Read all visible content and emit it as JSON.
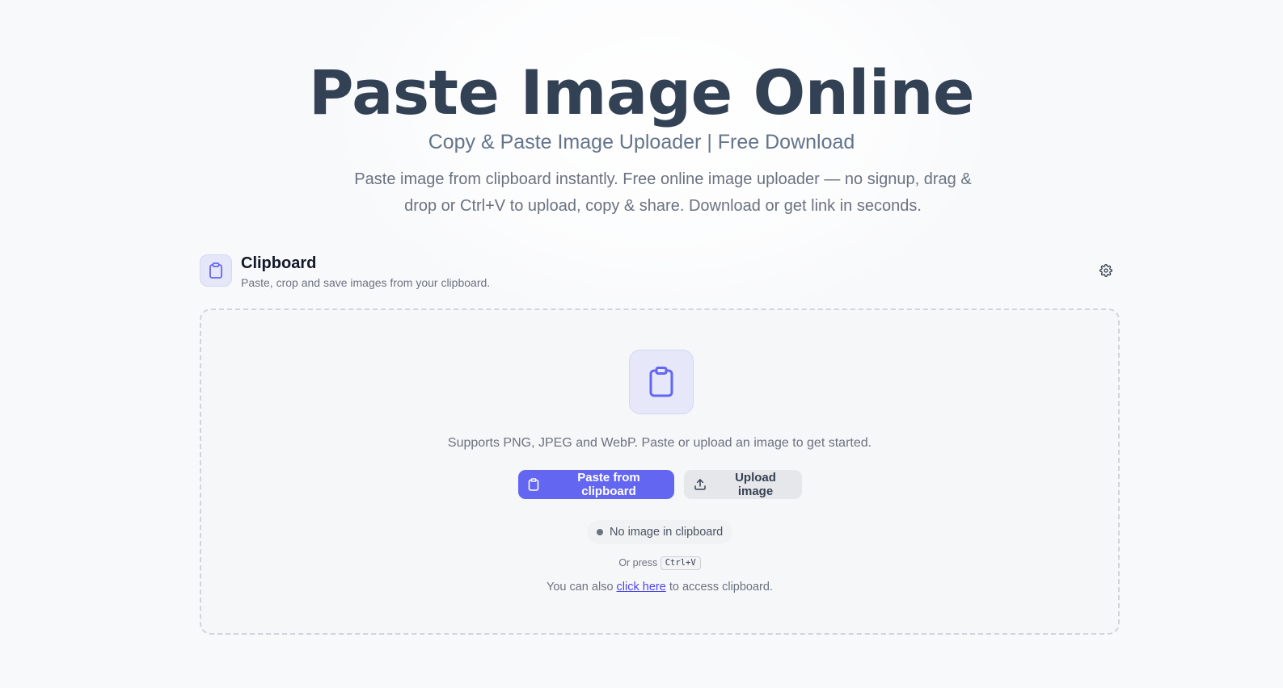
{
  "hero": {
    "title": "Paste Image Online",
    "subtitle": "Copy & Paste Image Uploader | Free Download",
    "description": "Paste image from clipboard instantly. Free online image uploader — no signup, drag & drop or Ctrl+V to upload, copy & share. Download or get link in seconds."
  },
  "section": {
    "title": "Clipboard",
    "subtitle": "Paste, crop and save images from your clipboard.",
    "icon": "clipboard-icon",
    "settings_icon": "gear-icon"
  },
  "dropzone": {
    "icon": "clipboard-icon",
    "supports_text": "Supports PNG, JPEG and WebP. Paste or upload an image to get started.",
    "paste_button": "Paste from clipboard",
    "upload_button": "Upload image",
    "status": "No image in clipboard",
    "or_press": "Or press",
    "shortcut": "Ctrl+V",
    "also_prefix": "You can also",
    "also_link": "click here",
    "also_suffix": "to access clipboard."
  },
  "colors": {
    "accent": "#6366f1",
    "title": "#334155",
    "muted": "#6b7280",
    "link": "#4f46e5"
  }
}
